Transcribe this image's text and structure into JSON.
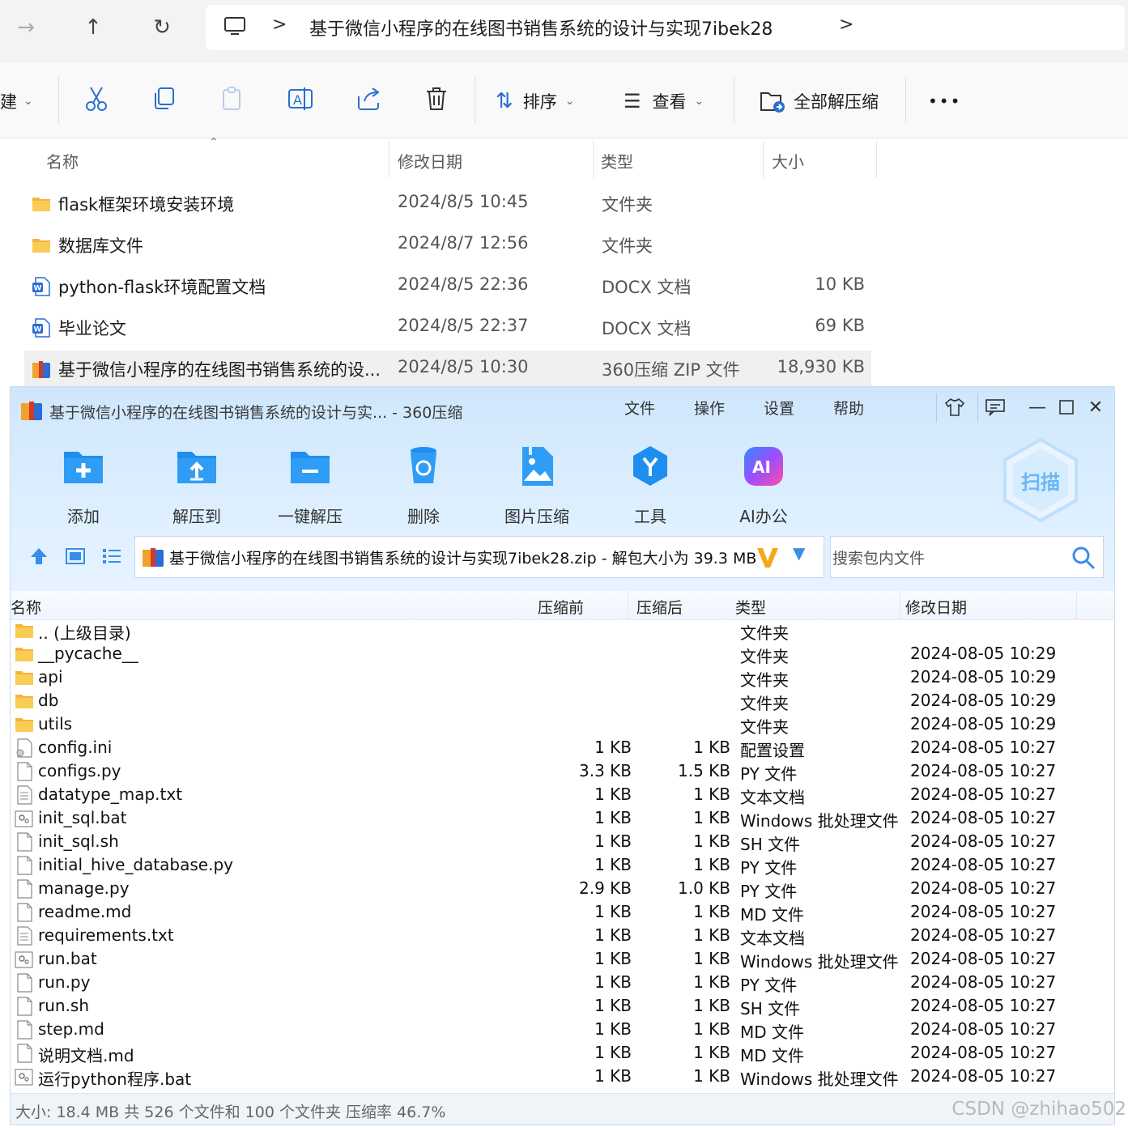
{
  "explorer": {
    "address": {
      "path": "基于微信小程序的在线图书销售系统的设计与实现7ibek28",
      "separator_1": ">",
      "separator_2": ">"
    },
    "toolbar": {
      "new_label": "建",
      "sort_label": "排序",
      "view_label": "查看",
      "extract_all_label": "全部解压缩",
      "more_label": "•••"
    },
    "columns": {
      "name": "名称",
      "modified": "修改日期",
      "type": "类型",
      "size": "大小"
    },
    "rows": [
      {
        "name": "flask框架环境安装环境",
        "date": "2024/8/5 10:45",
        "type": "文件夹",
        "size": "",
        "icon": "folder-icon"
      },
      {
        "name": "数据库文件",
        "date": "2024/8/7 12:56",
        "type": "文件夹",
        "size": "",
        "icon": "folder-icon"
      },
      {
        "name": "python-flask环境配置文档",
        "date": "2024/8/5 22:36",
        "type": "DOCX 文档",
        "size": "10 KB",
        "icon": "word-doc-icon"
      },
      {
        "name": "毕业论文",
        "date": "2024/8/5 22:37",
        "type": "DOCX 文档",
        "size": "69 KB",
        "icon": "word-doc-icon"
      },
      {
        "name": "基于微信小程序的在线图书销售系统的设...",
        "date": "2024/8/5 10:30",
        "type": "360压缩 ZIP 文件",
        "size": "18,930 KB",
        "icon": "zip-archive-icon"
      }
    ]
  },
  "archiver": {
    "title": "基于微信小程序的在线图书销售系统的设计与实... - 360压缩",
    "menu": [
      "文件",
      "操作",
      "设置",
      "帮助"
    ],
    "tools": [
      {
        "label": "添加",
        "icon": "add-folder-icon"
      },
      {
        "label": "解压到",
        "icon": "extract-to-icon"
      },
      {
        "label": "一键解压",
        "icon": "one-click-extract-icon"
      },
      {
        "label": "删除",
        "icon": "delete-bin-icon"
      },
      {
        "label": "图片压缩",
        "icon": "image-compress-icon"
      },
      {
        "label": "工具",
        "icon": "tools-icon"
      },
      {
        "label": "AI办公",
        "icon": "ai-office-icon"
      }
    ],
    "scan_label": "扫描",
    "path": "基于微信小程序的在线图书销售系统的设计与实现7ibek28.zip - 解包大小为 39.3 MB",
    "search_placeholder": "搜索包内文件",
    "columns": {
      "name": "名称",
      "before": "压缩前",
      "after": "压缩后",
      "type": "类型",
      "modified": "修改日期"
    },
    "files": [
      {
        "name": ".. (上级目录)",
        "before": "",
        "after": "",
        "type": "文件夹",
        "date": "",
        "icon": "folder-icon"
      },
      {
        "name": "__pycache__",
        "before": "",
        "after": "",
        "type": "文件夹",
        "date": "2024-08-05 10:29",
        "icon": "folder-icon"
      },
      {
        "name": "api",
        "before": "",
        "after": "",
        "type": "文件夹",
        "date": "2024-08-05 10:29",
        "icon": "folder-icon"
      },
      {
        "name": "db",
        "before": "",
        "after": "",
        "type": "文件夹",
        "date": "2024-08-05 10:29",
        "icon": "folder-icon"
      },
      {
        "name": "utils",
        "before": "",
        "after": "",
        "type": "文件夹",
        "date": "2024-08-05 10:29",
        "icon": "folder-icon"
      },
      {
        "name": "config.ini",
        "before": "1 KB",
        "after": "1 KB",
        "type": "配置设置",
        "date": "2024-08-05 10:27",
        "icon": "config-file-icon"
      },
      {
        "name": "configs.py",
        "before": "3.3 KB",
        "after": "1.5 KB",
        "type": "PY 文件",
        "date": "2024-08-05 10:27",
        "icon": "file-icon"
      },
      {
        "name": "datatype_map.txt",
        "before": "1 KB",
        "after": "1 KB",
        "type": "文本文档",
        "date": "2024-08-05 10:27",
        "icon": "text-file-icon"
      },
      {
        "name": "init_sql.bat",
        "before": "1 KB",
        "after": "1 KB",
        "type": "Windows 批处理文件",
        "date": "2024-08-05 10:27",
        "icon": "batch-file-icon"
      },
      {
        "name": "init_sql.sh",
        "before": "1 KB",
        "after": "1 KB",
        "type": "SH 文件",
        "date": "2024-08-05 10:27",
        "icon": "file-icon"
      },
      {
        "name": "initial_hive_database.py",
        "before": "1 KB",
        "after": "1 KB",
        "type": "PY 文件",
        "date": "2024-08-05 10:27",
        "icon": "file-icon"
      },
      {
        "name": "manage.py",
        "before": "2.9 KB",
        "after": "1.0 KB",
        "type": "PY 文件",
        "date": "2024-08-05 10:27",
        "icon": "file-icon"
      },
      {
        "name": "readme.md",
        "before": "1 KB",
        "after": "1 KB",
        "type": "MD 文件",
        "date": "2024-08-05 10:27",
        "icon": "file-icon"
      },
      {
        "name": "requirements.txt",
        "before": "1 KB",
        "after": "1 KB",
        "type": "文本文档",
        "date": "2024-08-05 10:27",
        "icon": "text-file-icon"
      },
      {
        "name": "run.bat",
        "before": "1 KB",
        "after": "1 KB",
        "type": "Windows 批处理文件",
        "date": "2024-08-05 10:27",
        "icon": "batch-file-icon"
      },
      {
        "name": "run.py",
        "before": "1 KB",
        "after": "1 KB",
        "type": "PY 文件",
        "date": "2024-08-05 10:27",
        "icon": "file-icon"
      },
      {
        "name": "run.sh",
        "before": "1 KB",
        "after": "1 KB",
        "type": "SH 文件",
        "date": "2024-08-05 10:27",
        "icon": "file-icon"
      },
      {
        "name": "step.md",
        "before": "1 KB",
        "after": "1 KB",
        "type": "MD 文件",
        "date": "2024-08-05 10:27",
        "icon": "file-icon"
      },
      {
        "name": "说明文档.md",
        "before": "1 KB",
        "after": "1 KB",
        "type": "MD 文件",
        "date": "2024-08-05 10:27",
        "icon": "file-icon"
      },
      {
        "name": "运行python程序.bat",
        "before": "1 KB",
        "after": "1 KB",
        "type": "Windows 批处理文件",
        "date": "2024-08-05 10:27",
        "icon": "batch-file-icon"
      }
    ],
    "status": "大小: 18.4 MB 共 526 个文件和 100 个文件夹 压缩率 46.7%"
  },
  "watermark": "CSDN @zhihao502",
  "colors": {
    "accent_blue": "#1e8ff0",
    "folder_yellow": "#f7c64a",
    "word_blue": "#2b6cd6",
    "archiver_bg": "#dbeeff"
  }
}
